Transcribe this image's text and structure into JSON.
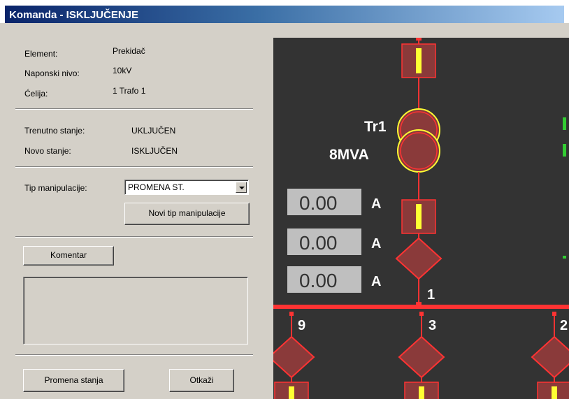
{
  "window": {
    "title": "Komanda - ISKLJUČENJE"
  },
  "info": {
    "element_label": "Element:",
    "element_value": "Prekidač",
    "voltage_label": "Naponski nivo:",
    "voltage_value": "10kV",
    "cell_label": "Ćelija:",
    "cell_value": "1 Trafo 1"
  },
  "state": {
    "current_label": "Trenutno stanje:",
    "current_value": "UKLJUČEN",
    "new_label": "Novo stanje:",
    "new_value": "ISKLJUČEN"
  },
  "manipulation": {
    "type_label": "Tip manipulacije:",
    "selected": "PROMENA ST.",
    "new_type_button": "Novi tip manipulacije"
  },
  "comment": {
    "button": "Komentar",
    "text": ""
  },
  "actions": {
    "change_state": "Promena stanja",
    "cancel": "Otkaži"
  },
  "scheme": {
    "transformer_name": "Tr1",
    "transformer_power": "8MVA",
    "currents": [
      {
        "value": "0.00",
        "unit": "A"
      },
      {
        "value": "0.00",
        "unit": "A"
      },
      {
        "value": "0.00",
        "unit": "A"
      }
    ],
    "busbar_label": "1",
    "feeders": [
      "9",
      "3",
      "2"
    ],
    "colors": {
      "background": "#333333",
      "energized": "#ff3333",
      "breaker_fill": "#8a3a3a",
      "switch_bar": "#ffff33"
    }
  }
}
